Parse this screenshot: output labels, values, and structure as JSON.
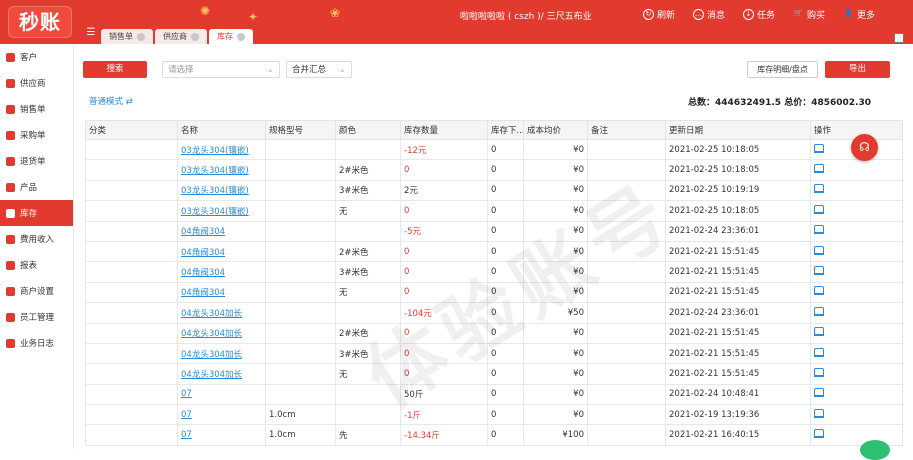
{
  "app": {
    "logo_text": "秒账"
  },
  "header": {
    "menu_glyph": "☰",
    "tabs": [
      {
        "label": "销售单",
        "active": false
      },
      {
        "label": "供应商",
        "active": false
      },
      {
        "label": "库存",
        "active": true
      }
    ],
    "user": "啦啦啦啦啦 ( cszh )/ 三尺五布业",
    "nav": [
      {
        "label": "刷新",
        "icon": "refresh-icon",
        "glyph": "↻"
      },
      {
        "label": "消息",
        "icon": "message-icon",
        "glyph": "…"
      },
      {
        "label": "任务",
        "icon": "task-icon",
        "glyph": "↓"
      },
      {
        "label": "购买",
        "icon": "cart-icon",
        "glyph": "🛒"
      },
      {
        "label": "更多",
        "icon": "user-icon",
        "glyph": "👤"
      }
    ]
  },
  "sidebar": {
    "items": [
      {
        "label": "客户",
        "icon": "customer-icon"
      },
      {
        "label": "供应商",
        "icon": "supplier-icon"
      },
      {
        "label": "销售单",
        "icon": "sales-order-icon"
      },
      {
        "label": "采购单",
        "icon": "purchase-order-icon"
      },
      {
        "label": "退货单",
        "icon": "return-order-icon"
      },
      {
        "label": "产品",
        "icon": "product-icon"
      },
      {
        "label": "库存",
        "icon": "inventory-icon",
        "active": true
      },
      {
        "label": "费用收入",
        "icon": "expense-income-icon"
      },
      {
        "label": "报表",
        "icon": "report-icon"
      },
      {
        "label": "商户设置",
        "icon": "merchant-settings-icon"
      },
      {
        "label": "员工管理",
        "icon": "staff-icon"
      },
      {
        "label": "业务日志",
        "icon": "log-icon"
      }
    ]
  },
  "toolbar": {
    "search_label": "搜索",
    "select_placeholder": "请选择",
    "merge_label": "合并汇总",
    "detail_button": "库存明细/盘点",
    "export_button": "导出"
  },
  "summary": {
    "mode_label": "普通模式 ⇄",
    "totals_text": "总数：444632491.5    总价：4856002.30"
  },
  "table": {
    "headers": [
      "分类",
      "名称",
      "规格型号",
      "颜色",
      "库存数量",
      "库存下...",
      "成本均价",
      "备注",
      "更新日期",
      "操作"
    ],
    "rows": [
      {
        "category": "",
        "name": "03龙头304(镶嵌)",
        "spec": "",
        "color": "",
        "qty": "-12元",
        "min": "0",
        "cost": "¥0",
        "note": "",
        "date": "2021-02-25 10:18:05"
      },
      {
        "category": "",
        "name": "03龙头304(镶嵌)",
        "spec": "",
        "color": "2#米色",
        "qty": "0",
        "min": "0",
        "cost": "¥0",
        "note": "",
        "date": "2021-02-25 10:18:05"
      },
      {
        "category": "",
        "name": "03龙头304(镶嵌)",
        "spec": "",
        "color": "3#米色",
        "qty": "2元",
        "min": "0",
        "cost": "¥0",
        "note": "",
        "date": "2021-02-25 10:19:19"
      },
      {
        "category": "",
        "name": "03龙头304(镶嵌)",
        "spec": "",
        "color": "无",
        "qty": "0",
        "min": "0",
        "cost": "¥0",
        "note": "",
        "date": "2021-02-25 10:18:05"
      },
      {
        "category": "",
        "name": "04角阀304",
        "spec": "",
        "color": "",
        "qty": "-5元",
        "min": "0",
        "cost": "¥0",
        "note": "",
        "date": "2021-02-24 23:36:01"
      },
      {
        "category": "",
        "name": "04角阀304",
        "spec": "",
        "color": "2#米色",
        "qty": "0",
        "min": "0",
        "cost": "¥0",
        "note": "",
        "date": "2021-02-21 15:51:45"
      },
      {
        "category": "",
        "name": "04角阀304",
        "spec": "",
        "color": "3#米色",
        "qty": "0",
        "min": "0",
        "cost": "¥0",
        "note": "",
        "date": "2021-02-21 15:51:45"
      },
      {
        "category": "",
        "name": "04角阀304",
        "spec": "",
        "color": "无",
        "qty": "0",
        "min": "0",
        "cost": "¥0",
        "note": "",
        "date": "2021-02-21 15:51:45"
      },
      {
        "category": "",
        "name": "04龙头304加长",
        "spec": "",
        "color": "",
        "qty": "-104元",
        "min": "0",
        "cost": "¥50",
        "note": "",
        "date": "2021-02-24 23:36:01"
      },
      {
        "category": "",
        "name": "04龙头304加长",
        "spec": "",
        "color": "2#米色",
        "qty": "0",
        "min": "0",
        "cost": "¥0",
        "note": "",
        "date": "2021-02-21 15:51:45"
      },
      {
        "category": "",
        "name": "04龙头304加长",
        "spec": "",
        "color": "3#米色",
        "qty": "0",
        "min": "0",
        "cost": "¥0",
        "note": "",
        "date": "2021-02-21 15:51:45"
      },
      {
        "category": "",
        "name": "04龙头304加长",
        "spec": "",
        "color": "无",
        "qty": "0",
        "min": "0",
        "cost": "¥0",
        "note": "",
        "date": "2021-02-21 15:51:45"
      },
      {
        "category": "",
        "name": "07",
        "spec": "",
        "color": "",
        "qty": "50斤",
        "min": "0",
        "cost": "¥0",
        "note": "",
        "date": "2021-02-24 10:48:41"
      },
      {
        "category": "",
        "name": "07",
        "spec": "1.0cm",
        "color": "",
        "qty": "-1斤",
        "min": "0",
        "cost": "¥0",
        "note": "",
        "date": "2021-02-19 13:19:36"
      },
      {
        "category": "",
        "name": "07",
        "spec": "1.0cm",
        "color": "先",
        "qty": "-14.34斤",
        "min": "0",
        "cost": "¥100",
        "note": "",
        "date": "2021-02-21 16:40:15"
      }
    ]
  },
  "watermark": "体验账号",
  "colors": {
    "brand": "#e33a30",
    "link": "#2a8bd6"
  }
}
